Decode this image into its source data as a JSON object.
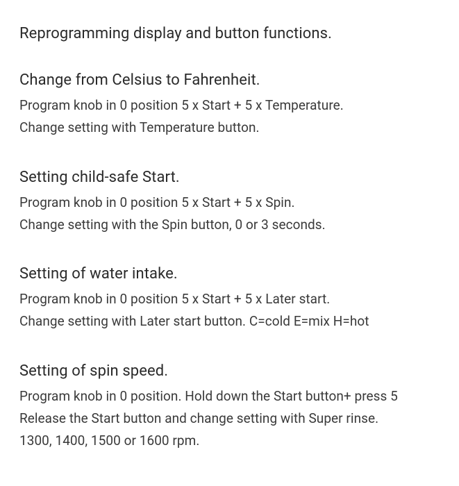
{
  "title": "Reprogramming display and button functions.",
  "sections": [
    {
      "heading": "Change from Celsius to Fahrenheit.",
      "lines": [
        "Program knob in 0 position 5 x Start + 5 x Temperature.",
        "Change setting with Temperature button."
      ]
    },
    {
      "heading": "Setting child-safe Start.",
      "lines": [
        "Program knob in 0 position 5 x Start + 5 x Spin.",
        "Change setting with the Spin button, 0 or 3 seconds."
      ]
    },
    {
      "heading": "Setting of water intake.",
      "lines": [
        "Program knob in 0 position 5 x Start + 5 x Later start.",
        "Change setting with Later start button. C=cold E=mix H=hot"
      ]
    },
    {
      "heading": "Setting of spin speed.",
      "lines": [
        "Program knob in 0 position. Hold down the Start button+ press 5",
        "Release the Start button and change setting with Super rinse.",
        "1300, 1400, 1500 or 1600 rpm."
      ]
    }
  ]
}
